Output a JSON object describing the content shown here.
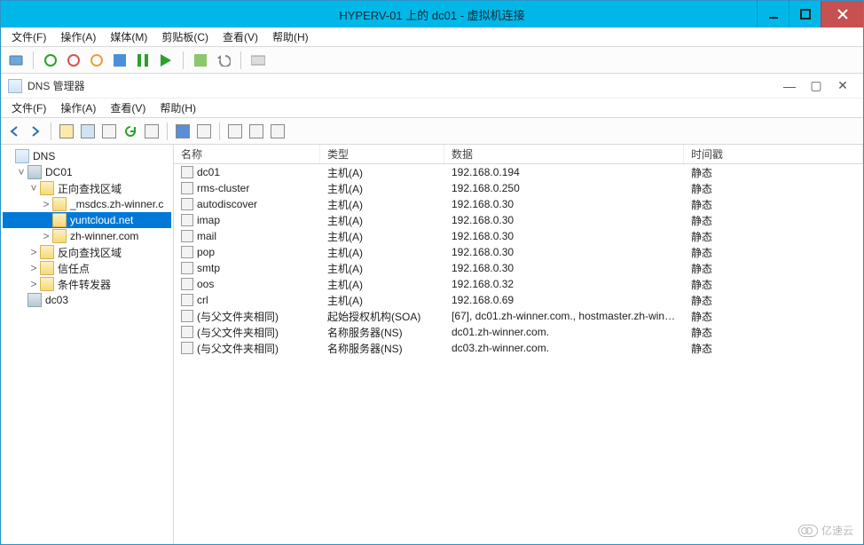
{
  "outer": {
    "title": "HYPERV-01 上的 dc01 - 虚拟机连接",
    "menu": {
      "file": "文件(F)",
      "action": "操作(A)",
      "media": "媒体(M)",
      "clipboard": "剪贴板(C)",
      "view": "查看(V)",
      "help": "帮助(H)"
    }
  },
  "inner": {
    "title": "DNS 管理器",
    "menu": {
      "file": "文件(F)",
      "action": "操作(A)",
      "view": "查看(V)",
      "help": "帮助(H)"
    }
  },
  "tree": {
    "root": "DNS",
    "nodes": [
      {
        "label": "DC01",
        "expanded": true,
        "indent": 1,
        "type": "server",
        "children": [
          {
            "label": "正向查找区域",
            "expanded": true,
            "indent": 2,
            "type": "folder",
            "children": [
              {
                "label": "_msdcs.zh-winner.c",
                "indent": 3,
                "type": "folder",
                "expandable": true
              },
              {
                "label": "yuntcloud.net",
                "indent": 3,
                "type": "folder",
                "selected": true
              },
              {
                "label": "zh-winner.com",
                "indent": 3,
                "type": "folder",
                "expandable": true
              }
            ]
          },
          {
            "label": "反向查找区域",
            "indent": 2,
            "type": "folder",
            "expandable": true
          },
          {
            "label": "信任点",
            "indent": 2,
            "type": "folder",
            "expandable": true
          },
          {
            "label": "条件转发器",
            "indent": 2,
            "type": "folder",
            "expandable": true
          }
        ]
      },
      {
        "label": "dc03",
        "indent": 1,
        "type": "server"
      }
    ]
  },
  "list": {
    "columns": {
      "name": "名称",
      "type": "类型",
      "data": "数据",
      "ts": "时间戳"
    },
    "rows": [
      {
        "name": "dc01",
        "type": "主机(A)",
        "data": "192.168.0.194",
        "ts": "静态"
      },
      {
        "name": "rms-cluster",
        "type": "主机(A)",
        "data": "192.168.0.250",
        "ts": "静态"
      },
      {
        "name": "autodiscover",
        "type": "主机(A)",
        "data": "192.168.0.30",
        "ts": "静态"
      },
      {
        "name": "imap",
        "type": "主机(A)",
        "data": "192.168.0.30",
        "ts": "静态"
      },
      {
        "name": "mail",
        "type": "主机(A)",
        "data": "192.168.0.30",
        "ts": "静态"
      },
      {
        "name": "pop",
        "type": "主机(A)",
        "data": "192.168.0.30",
        "ts": "静态"
      },
      {
        "name": "smtp",
        "type": "主机(A)",
        "data": "192.168.0.30",
        "ts": "静态"
      },
      {
        "name": "oos",
        "type": "主机(A)",
        "data": "192.168.0.32",
        "ts": "静态"
      },
      {
        "name": "crl",
        "type": "主机(A)",
        "data": "192.168.0.69",
        "ts": "静态"
      },
      {
        "name": "(与父文件夹相同)",
        "type": "起始授权机构(SOA)",
        "data": "[67], dc01.zh-winner.com., hostmaster.zh-winn...",
        "ts": "静态"
      },
      {
        "name": "(与父文件夹相同)",
        "type": "名称服务器(NS)",
        "data": "dc01.zh-winner.com.",
        "ts": "静态"
      },
      {
        "name": "(与父文件夹相同)",
        "type": "名称服务器(NS)",
        "data": "dc03.zh-winner.com.",
        "ts": "静态"
      }
    ]
  },
  "watermark": "亿速云"
}
